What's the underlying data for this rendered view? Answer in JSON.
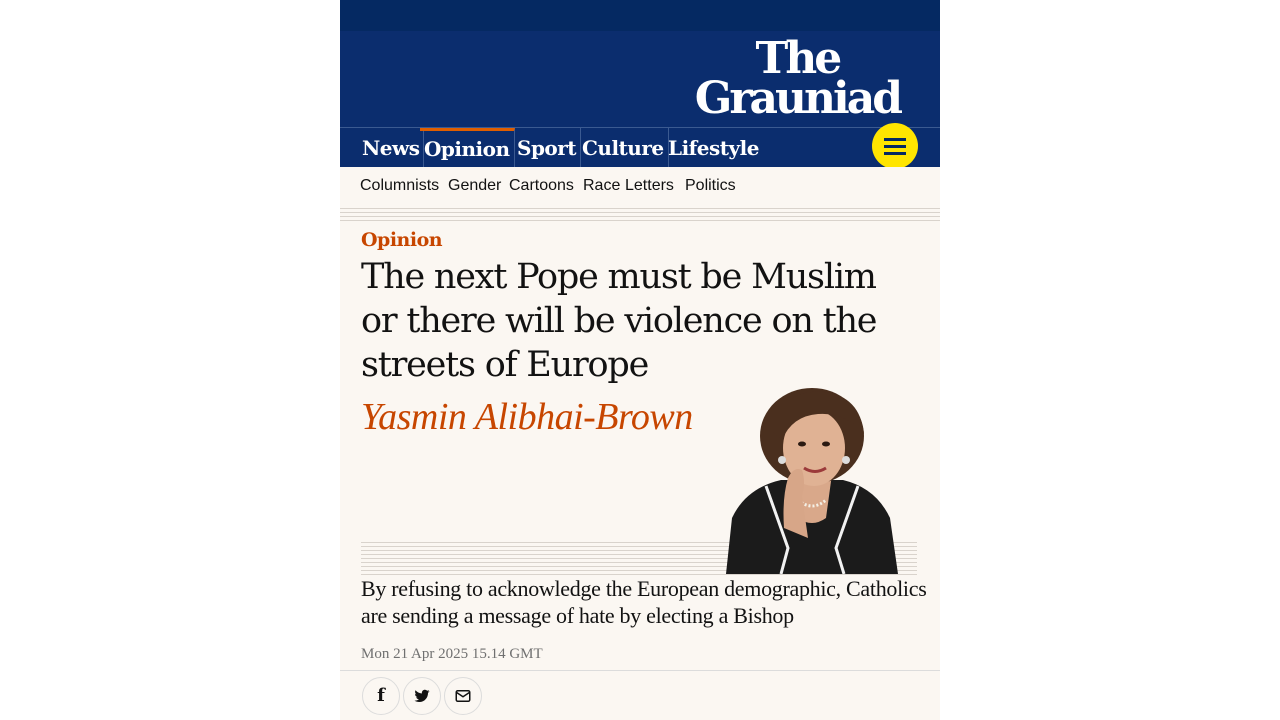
{
  "brand": {
    "logo_line1": "The",
    "logo_line2": "Grauniad"
  },
  "nav": {
    "items": [
      {
        "label": "News"
      },
      {
        "label": "Opinion",
        "active": true
      },
      {
        "label": "Sport"
      },
      {
        "label": "Culture"
      },
      {
        "label": "Lifestyle"
      }
    ],
    "menu_icon": "hamburger-icon"
  },
  "subnav": {
    "items": [
      "Columnists",
      "Gender",
      "Cartoons",
      "Race",
      "Letters",
      "Politics"
    ]
  },
  "article": {
    "kicker": "Opinion",
    "headline": "The next Pope must be Muslim or there will be violence on the streets of Europe",
    "byline": "Yasmin Alibhai-Brown",
    "standfirst": "By refusing to acknowledge the European demographic, Catholics are sending a message of hate by electing a Bishop",
    "dateline": "Mon 21 Apr 2025 15.14 GMT"
  },
  "share": {
    "icons": [
      "facebook-icon",
      "twitter-icon",
      "email-icon"
    ]
  },
  "colors": {
    "brand_blue": "#052962",
    "nav_blue": "#0b2d6e",
    "opinion_orange": "#c74600",
    "menu_yellow": "#ffe500",
    "page_bg": "#fbf7f2"
  }
}
